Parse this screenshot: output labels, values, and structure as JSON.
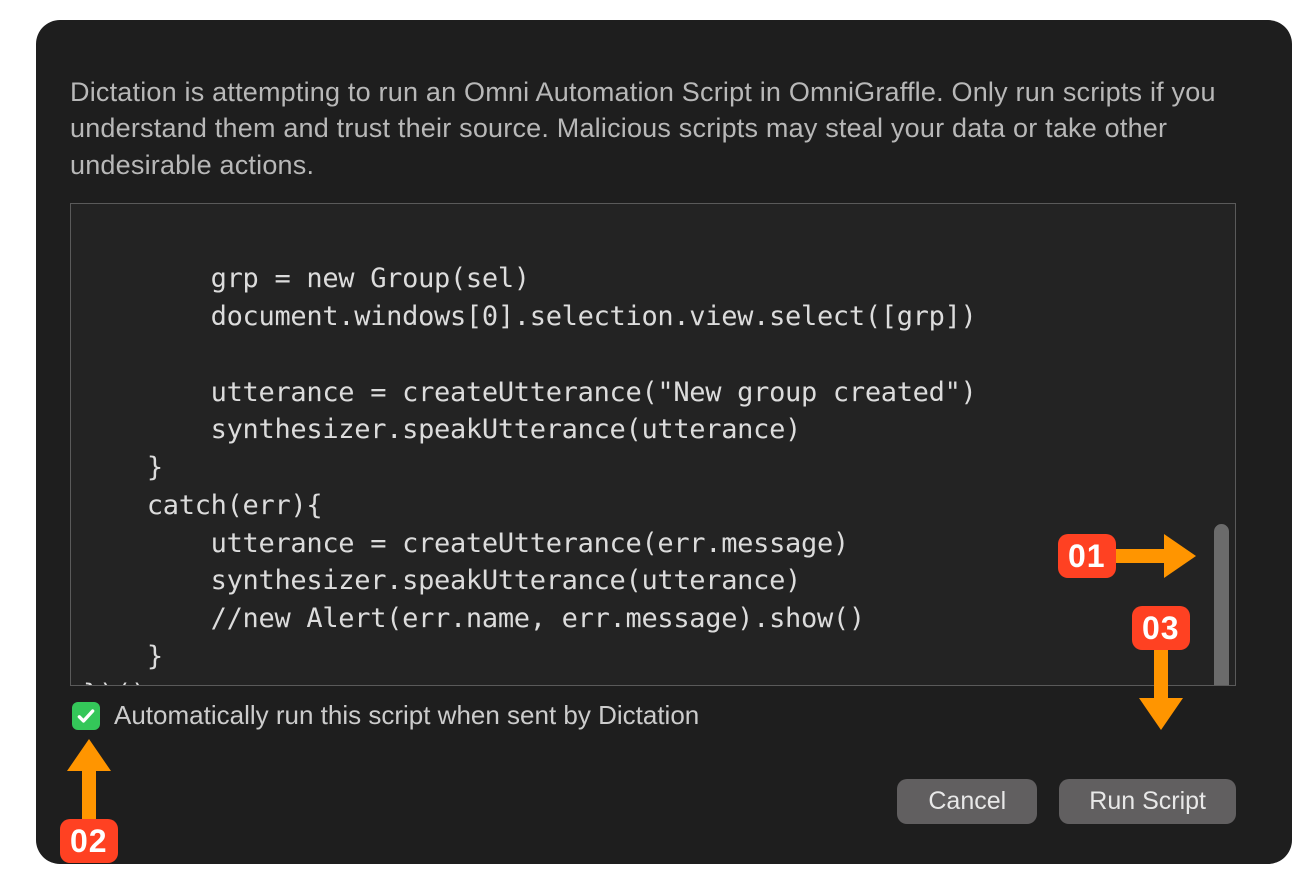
{
  "dialog": {
    "warning_text": "Dictation is attempting to run an Omni Automation Script in OmniGraffle. Only run scripts if you understand them and trust their source. Malicious scripts may steal your data or take other undesirable actions.",
    "script_content": "\n        grp = new Group(sel)\n        document.windows[0].selection.view.select([grp])\n\n        utterance = createUtterance(\"New group created\")\n        synthesizer.speakUtterance(utterance)\n    }\n    catch(err){\n        utterance = createUtterance(err.message)\n        synthesizer.speakUtterance(utterance)\n        //new Alert(err.name, err.message).show()\n    }\n})();",
    "checkbox_label": "Automatically run this script when sent by Dictation",
    "checkbox_checked": true,
    "buttons": {
      "cancel": "Cancel",
      "run": "Run Script"
    }
  },
  "annotations": {
    "item1": "01",
    "item2": "02",
    "item3": "03"
  }
}
